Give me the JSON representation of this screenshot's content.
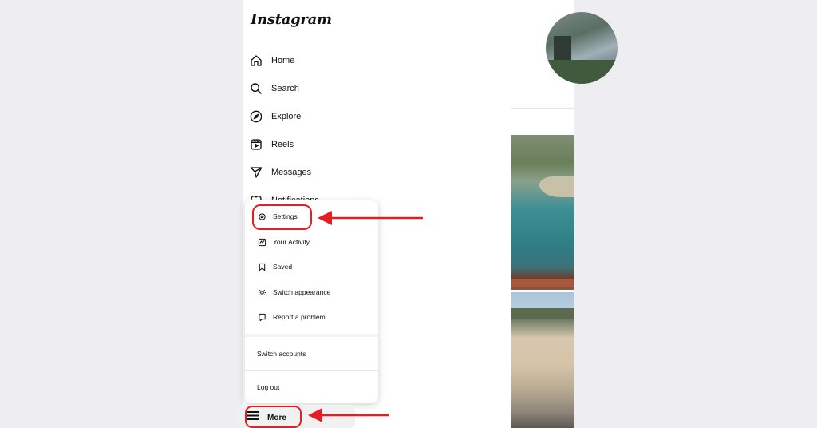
{
  "app": {
    "logo_text": "Instagram"
  },
  "sidebar": {
    "items": [
      {
        "label": "Home",
        "icon": "home-icon"
      },
      {
        "label": "Search",
        "icon": "search-icon"
      },
      {
        "label": "Explore",
        "icon": "compass-icon"
      },
      {
        "label": "Reels",
        "icon": "reels-icon"
      },
      {
        "label": "Messages",
        "icon": "send-icon"
      },
      {
        "label": "Notifications",
        "icon": "heart-icon"
      }
    ],
    "more_label": "More",
    "more_icon": "hamburger-icon"
  },
  "more_menu": {
    "items": [
      {
        "label": "Settings",
        "icon": "gear-icon"
      },
      {
        "label": "Your Activity",
        "icon": "activity-icon"
      },
      {
        "label": "Saved",
        "icon": "bookmark-icon"
      },
      {
        "label": "Switch appearance",
        "icon": "sun-icon"
      },
      {
        "label": "Report a problem",
        "icon": "report-icon"
      }
    ],
    "switch_accounts": "Switch accounts",
    "log_out": "Log out"
  },
  "annotation": {
    "color": "#e51e26"
  }
}
